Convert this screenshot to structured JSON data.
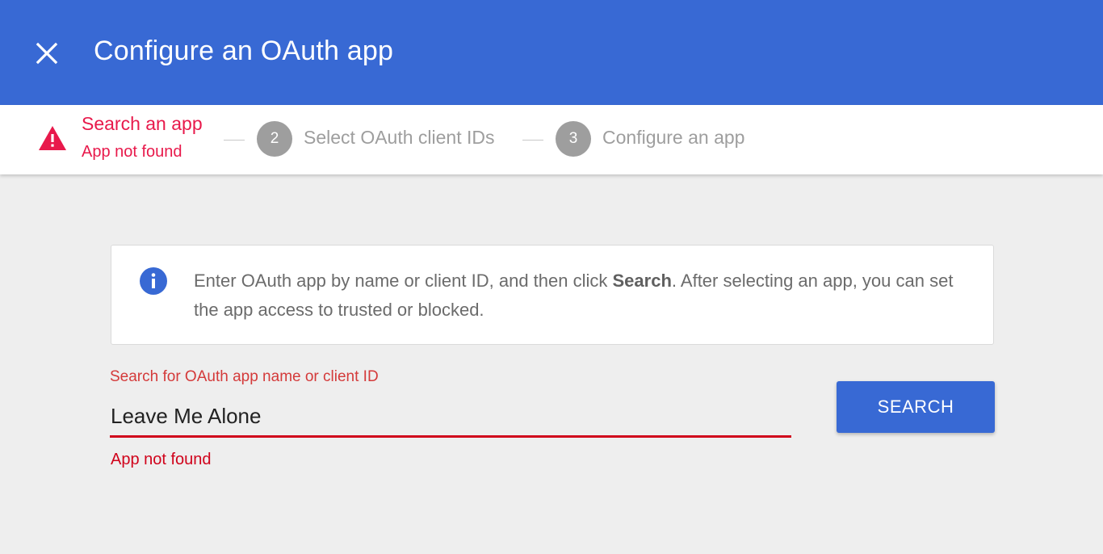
{
  "header": {
    "title": "Configure an OAuth app",
    "close_icon": "close-icon",
    "background_color": "#3869d4"
  },
  "stepper": {
    "steps": [
      {
        "number": "",
        "label": "Search an app",
        "status": "error",
        "error_text": "App not found",
        "icon": "warning-icon",
        "color": "#e8194b"
      },
      {
        "number": "2",
        "label": "Select OAuth client IDs",
        "status": "inactive"
      },
      {
        "number": "3",
        "label": "Configure an app",
        "status": "inactive"
      }
    ]
  },
  "info": {
    "icon": "info-icon",
    "text_before": "Enter OAuth app by name or client ID, and then click ",
    "text_bold": "Search",
    "text_after": ". After selecting an app, you can set the app access to trusted or blocked."
  },
  "search": {
    "label": "Search for OAuth app name or client ID",
    "value": "Leave Me Alone",
    "error": "App not found",
    "button_label": "SEARCH",
    "error_color": "#d0021b"
  }
}
